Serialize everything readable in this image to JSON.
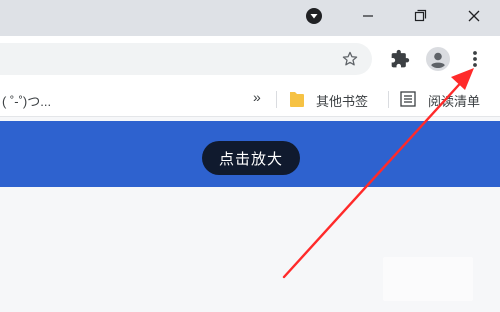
{
  "window": {
    "media_icon": "media-control-icon",
    "minimize_icon": "minimize-icon",
    "restore_icon": "restore-icon",
    "close_icon": "close-icon"
  },
  "toolbar": {
    "bookmark_star_icon": "star-outline-icon",
    "extensions_icon": "puzzle-piece-icon",
    "profile_icon": "profile-avatar-icon",
    "menu_icon": "vertical-dots-menu-icon"
  },
  "bookmarks_bar": {
    "truncated_item": "( ˚-˚)つ...",
    "overflow": "»",
    "other_bookmarks": "其他书签",
    "reading_list": "阅读清单"
  },
  "banner": {
    "zoom_label": "点击放大",
    "color": "#2e62cf"
  },
  "annotation": {
    "arrow_color": "#ff2a2a",
    "points_to": "vertical-dots-menu-icon"
  }
}
